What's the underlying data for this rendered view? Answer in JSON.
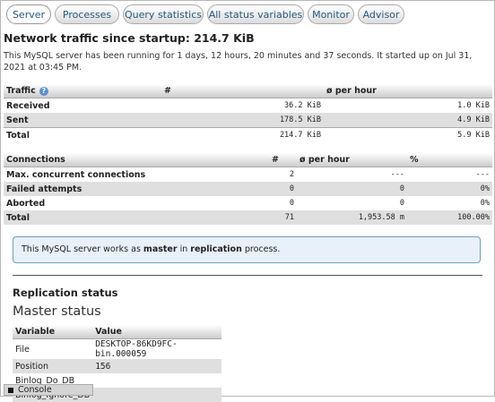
{
  "tabs": [
    "Server",
    "Processes",
    "Query statistics",
    "All status variables",
    "Monitor",
    "Advisor"
  ],
  "title": "Network traffic since startup: 214.7 KiB",
  "intro": "This MySQL server has been running for 1 days, 12 hours, 20 minutes and 37 seconds. It started up on Jul 31, 2021 at 03:45 PM.",
  "traffic": {
    "headers": [
      "Traffic",
      "#",
      "ø per hour"
    ],
    "rows": [
      {
        "label": "Received",
        "total": "36.2 KiB",
        "per_hour": "1.0 KiB"
      },
      {
        "label": "Sent",
        "total": "178.5 KiB",
        "per_hour": "4.9 KiB"
      },
      {
        "label": "Total",
        "total": "214.7 KiB",
        "per_hour": "5.9 KiB"
      }
    ]
  },
  "connections": {
    "headers": [
      "Connections",
      "#",
      "ø per hour",
      "%"
    ],
    "rows": [
      {
        "label": "Max. concurrent connections",
        "count": "2",
        "per_hour": "---",
        "percent": "---"
      },
      {
        "label": "Failed attempts",
        "count": "0",
        "per_hour": "0",
        "percent": "0%"
      },
      {
        "label": "Aborted",
        "count": "0",
        "per_hour": "0",
        "percent": "0%"
      },
      {
        "label": "Total",
        "count": "71",
        "per_hour": "1,953.58 m",
        "percent": "100.00%"
      }
    ]
  },
  "notice": {
    "pre": "This MySQL server works as ",
    "role": "master",
    "mid": " in ",
    "process": "replication",
    "post": " process."
  },
  "replication_heading": "Replication status",
  "master_heading": "Master status",
  "master": {
    "headers": [
      "Variable",
      "Value"
    ],
    "rows": [
      {
        "variable": "File",
        "value": "DESKTOP-86KD9FC-bin.000059"
      },
      {
        "variable": "Position",
        "value": "156"
      },
      {
        "variable": "Binlog_Do_DB",
        "value": ""
      },
      {
        "variable": "Binlog_Ignore_DB",
        "value": ""
      }
    ]
  },
  "console_label": "Console"
}
